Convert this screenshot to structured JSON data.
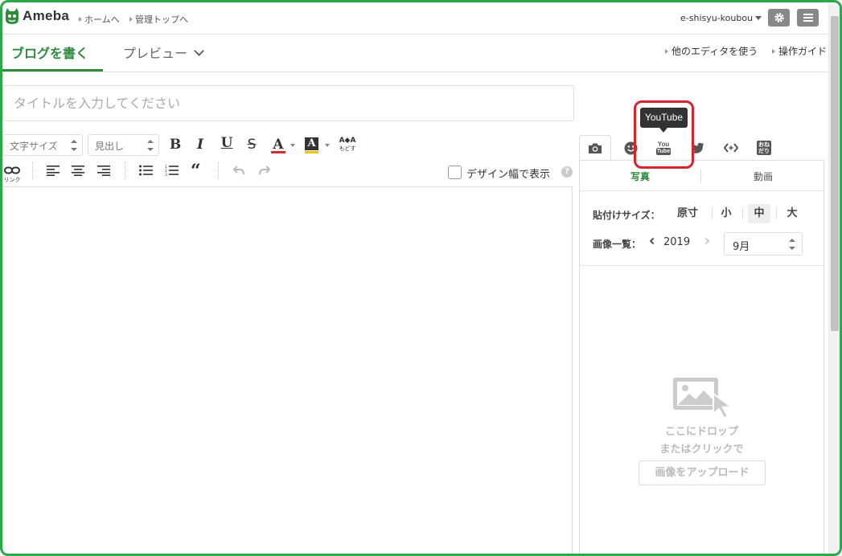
{
  "header": {
    "logo_text": "Ameba",
    "links": [
      "ホームへ",
      "管理トップへ"
    ],
    "username": "e-shisyu-koubou",
    "settings_icon": "gear-icon",
    "menu_icon": "hamburger-icon"
  },
  "tabs": {
    "write": "ブログを書く",
    "preview": "プレビュー",
    "other_editor": "他のエディタを使う",
    "guide": "操作ガイド"
  },
  "editor": {
    "title_placeholder": "タイトルを入力してください",
    "font_size_select": "文字サイズ",
    "heading_select": "見出し",
    "bold": "B",
    "italic": "I",
    "underline": "U",
    "strike": "S",
    "font_color": "A",
    "bg_color": "A",
    "reset_label_top": "A◆A",
    "reset_label_bottom": "もどす",
    "link_label": "リンク",
    "design_width_label": "デザイン幅で表示",
    "help": "?"
  },
  "sidebar": {
    "tabs": [
      "camera-icon",
      "emoji-icon",
      "youtube-icon",
      "twitter-icon",
      "embed-code-icon",
      "onedari-icon"
    ],
    "youtube_icon_text_top": "You",
    "youtube_icon_text_bottom": "Tube",
    "onedari_text_top": "おね",
    "onedari_text_bottom": "だり",
    "tooltip": "YouTube",
    "sub_tabs": [
      "写真",
      "動画"
    ],
    "paste_size_label": "貼付けサイズ：",
    "sizes": [
      "原寸",
      "小",
      "中",
      "大"
    ],
    "active_size": "中",
    "image_list_label": "画像一覧：",
    "year": "2019",
    "month": "9月",
    "drop_line1": "ここにドロップ",
    "drop_line2": "またはクリックで",
    "upload_button": "画像をアップロード"
  },
  "colors": {
    "brand_green": "#2e8b3e",
    "frame_green": "#2aa84a",
    "highlight_red": "#d9242b",
    "font_color_bar": "#d32f2f",
    "bg_color_bar": "#f2c200"
  }
}
